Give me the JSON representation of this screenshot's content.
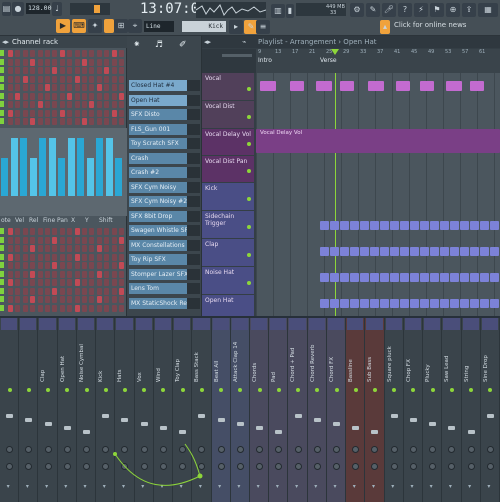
{
  "toolbar": {
    "tempo": "128.000",
    "time": "13:07:07",
    "time_suffix": "\"",
    "pattern_mode": "Line",
    "current_channel": "Kick",
    "memory": "449 MB",
    "cpu_value": "33",
    "online_news": "Click for online news",
    "accent": "#f0a23c"
  },
  "channel_rack": {
    "title": "Channel rack",
    "piano_labels": [
      "ote",
      "Vel",
      "Rel",
      "Fine",
      "Pan",
      "X",
      "Y",
      "Shift"
    ]
  },
  "browser": {
    "channels": [
      "Closed Hat #4",
      "Open Hat",
      "SFX Disto",
      "FLS_Gun 001",
      "Toy Scratch SFX",
      "Crash",
      "Crash #2",
      "SFX Cym Noisy",
      "SFX Cym Noisy #2",
      "SFX 8bit Drop",
      "Swagen Whistle SFX",
      "MX Constellations Sh...",
      "Toy Rip SFX",
      "Stomper Lazer SFX",
      "Lens Tom",
      "MX StaticShock Retro..."
    ]
  },
  "playlist": {
    "breadcrumb": "Playlist - Arrangement › Open Hat",
    "ruler_labels": [
      "Intro",
      "Verse"
    ],
    "bar_numbers": [
      "9",
      "13",
      "17",
      "21",
      "25",
      "29",
      "33",
      "37",
      "41",
      "45",
      "49",
      "53",
      "57",
      "61"
    ],
    "clip_label": "Vocal Delay Vol",
    "tracks": [
      {
        "name": "Vocal",
        "color": "#51405a"
      },
      {
        "name": "Vocal Dist",
        "color": "#51405a"
      },
      {
        "name": "Vocal Delay Vol",
        "color": "#5c3266"
      },
      {
        "name": "Vocal Dist Pan",
        "color": "#5c3266"
      },
      {
        "name": "Kick",
        "color": "#4a4e86"
      },
      {
        "name": "Sidechain Trigger",
        "color": "#4a4e86"
      },
      {
        "name": "Clap",
        "color": "#4a4e86"
      },
      {
        "name": "Noise Hat",
        "color": "#4a4e86"
      },
      {
        "name": "Open Hat",
        "color": "#4a4e86"
      }
    ]
  },
  "mixer": {
    "strips": [
      "Clap",
      "Open Hat",
      "Noise Cymbal",
      "Kick",
      "Hats",
      "Vox",
      "Wind",
      "Toy Clap",
      "Bass Stack",
      "Beat All",
      "Attack Clap 14",
      "Chords",
      "Pad",
      "Chord + Pad",
      "Chord Reverb",
      "Chord FX",
      "Bassline",
      "Sub Bass",
      "Square pluck",
      "Chop FX",
      "Plucky",
      "Saw Lead",
      "String",
      "Sine Drop"
    ]
  }
}
